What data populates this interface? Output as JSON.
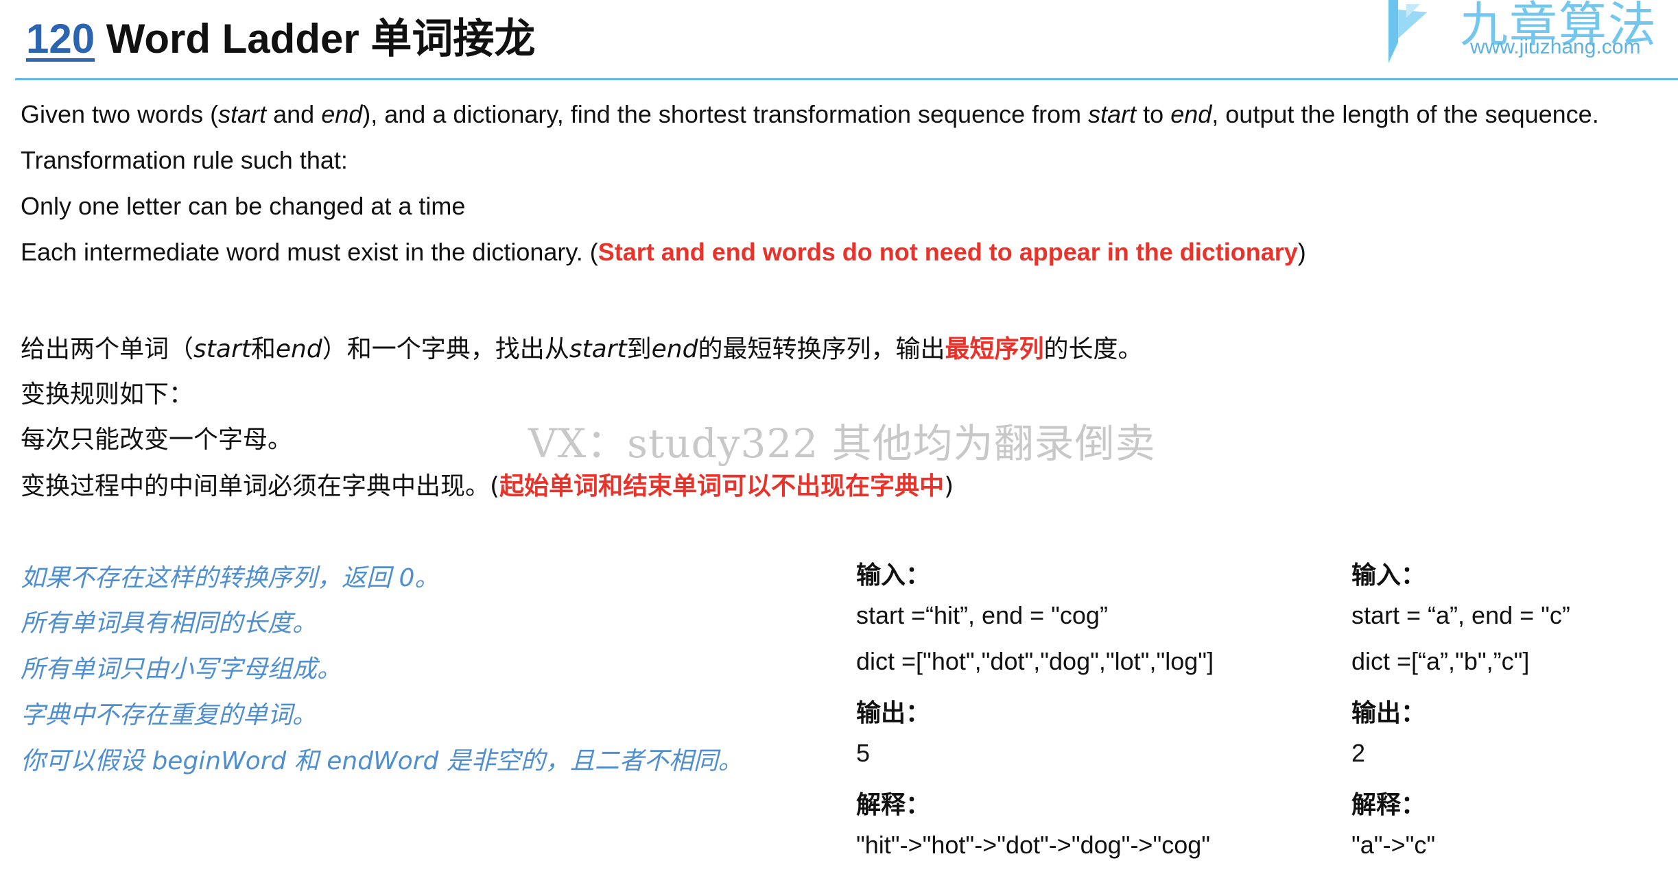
{
  "header": {
    "problem_number": "120",
    "problem_title": "Word Ladder 单词接龙"
  },
  "logo": {
    "brand_cn": "九章算法",
    "url": "www.jiuzhang.com"
  },
  "english": {
    "line1": {
      "p1": "Given two words (",
      "start": "start",
      "p2": " and ",
      "end": "end",
      "p3": "), and a dictionary, find the shortest transformation sequence from ",
      "start2": "start",
      "p4": " to ",
      "end2": "end",
      "p5": ", output the length of the sequence."
    },
    "line2": "Transformation rule such that:",
    "line3": "Only one letter can be changed at a time",
    "line4": {
      "p1": "Each intermediate word must exist in the dictionary. (",
      "red": "Start and end words do not need to appear in the dictionary",
      "p2": ")"
    }
  },
  "chinese": {
    "line1": {
      "p1": "给出两个单词（",
      "start": "start",
      "p2": "和",
      "end": "end",
      "p3": "）和一个字典，找出从",
      "start2": "start",
      "p4": "到",
      "end2": "end",
      "p5": "的最短转换序列，输出",
      "red": "最短序列",
      "p6": "的长度。"
    },
    "line2": "变换规则如下：",
    "line3": "每次只能改变一个字母。",
    "line4": {
      "p1": "变换过程中的中间单词必须在字典中出现。(",
      "red": "起始单词和结束单词可以不出现在字典中",
      "p2": ")"
    }
  },
  "notes": [
    "如果不存在这样的转换序列，返回 0。",
    "所有单词具有相同的长度。",
    "所有单词只由小写字母组成。",
    "字典中不存在重复的单词。",
    "你可以假设 beginWord 和 endWord 是非空的，且二者不相同。"
  ],
  "example1": {
    "input_label": "输入：",
    "start_line": "start =“hit”, end = \"cog”",
    "dict_line": "dict =[\"hot\",\"dot\",\"dog\",\"lot\",\"log\"]",
    "output_label": "输出：",
    "output_value": "5",
    "explain_label": "解释：",
    "explain_value": "\"hit\"->\"hot\"->\"dot\"->\"dog\"->\"cog\""
  },
  "example2": {
    "input_label": "输入：",
    "start_line": "start = “a”, end = \"c”",
    "dict_line": "dict =[“a”,\"b\",”c\"]",
    "output_label": "输出：",
    "output_value": "2",
    "explain_label": "解释：",
    "explain_value": "\"a\"->\"c\""
  },
  "watermark": "VX：study322 其他均为翻录倒卖",
  "colors": {
    "accent_blue": "#2b65b0",
    "rule": "#63b6e8",
    "red": "#e8322a",
    "note_blue": "#4f8fd0"
  }
}
